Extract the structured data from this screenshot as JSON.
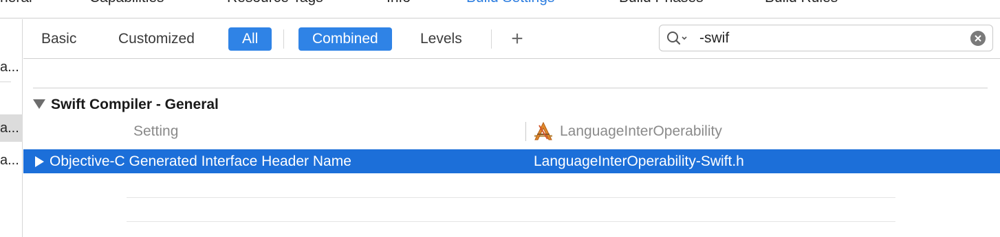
{
  "top_tabs": [
    {
      "label": "neral",
      "active": false
    },
    {
      "label": "Capabilities",
      "active": false
    },
    {
      "label": "Resource Tags",
      "active": false
    },
    {
      "label": "Info",
      "active": false
    },
    {
      "label": "Build Settings",
      "active": true
    },
    {
      "label": "Build Phases",
      "active": false
    },
    {
      "label": "Build Rules",
      "active": false
    }
  ],
  "sidebar": {
    "items": [
      {
        "label": "a..."
      },
      {
        "label": "a..."
      },
      {
        "label": "a..."
      }
    ]
  },
  "toolbar": {
    "basic": "Basic",
    "customized": "Customized",
    "all": "All",
    "combined": "Combined",
    "levels": "Levels",
    "add_symbol": "+"
  },
  "search": {
    "value": "-swif"
  },
  "section": {
    "title": "Swift Compiler - General",
    "col_setting": "Setting",
    "col_target": "LanguageInterOperability"
  },
  "rows": [
    {
      "name": "Objective-C Generated Interface Header Name",
      "value": "LanguageInterOperability-Swift.h",
      "selected": true
    }
  ],
  "colors": {
    "accent": "#2f83e6",
    "selection": "#1c6fd9",
    "active_tab": "#2d7ee0"
  }
}
